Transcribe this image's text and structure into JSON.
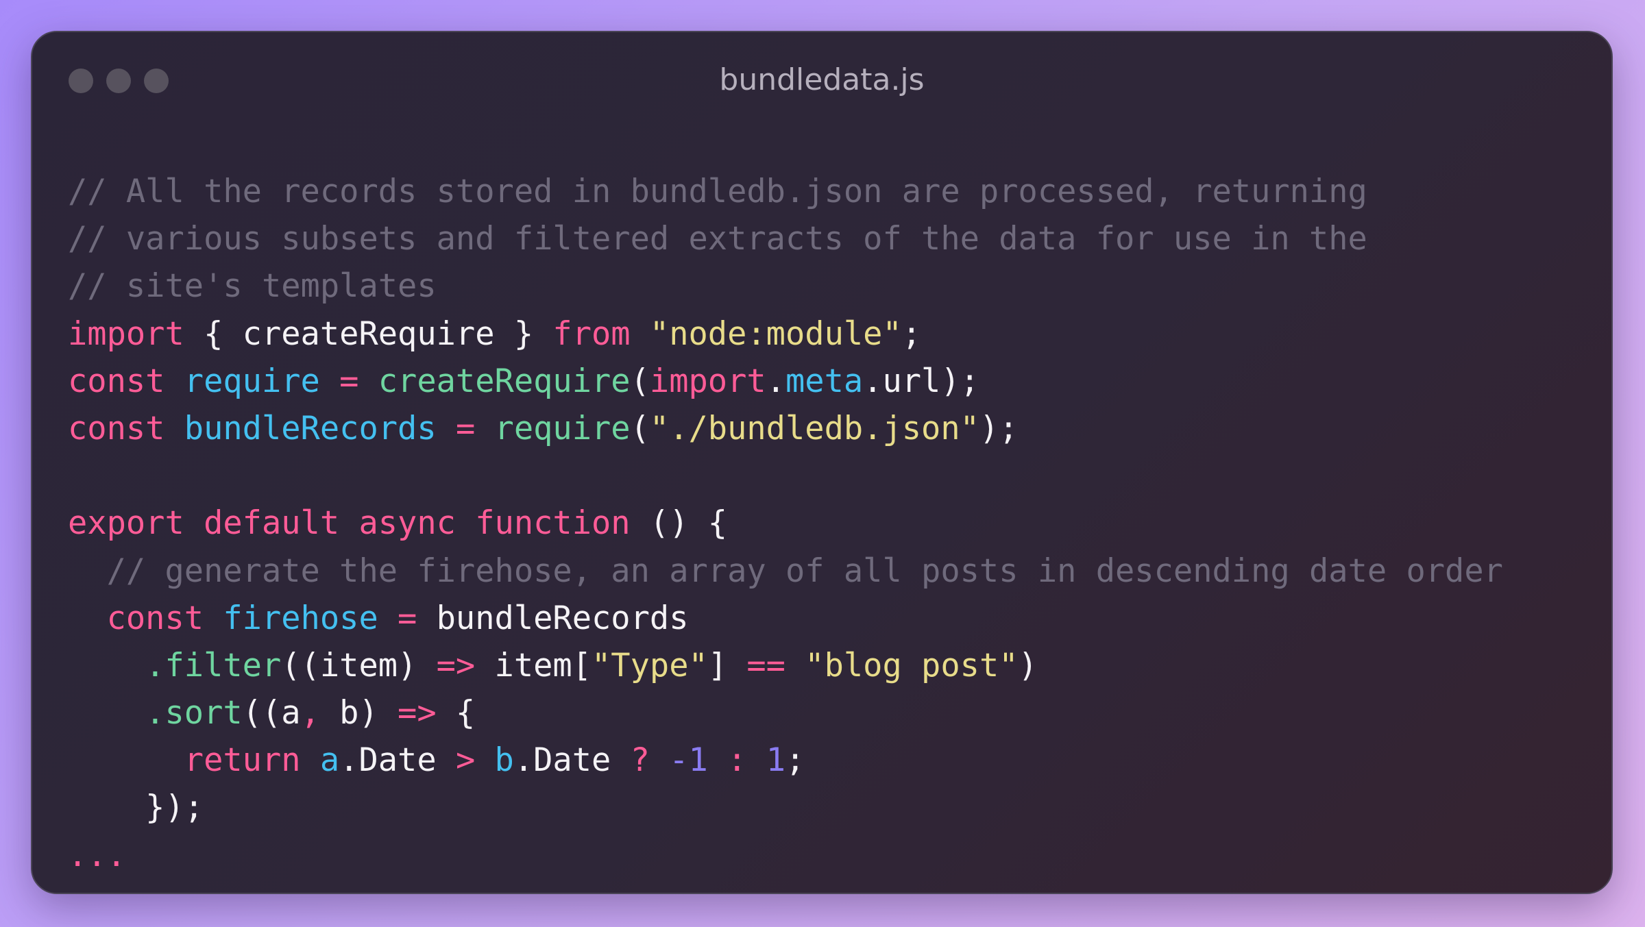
{
  "window": {
    "title": "bundledata.js",
    "controls": [
      "close",
      "minimize",
      "maximize"
    ]
  },
  "colors": {
    "background_gradient": [
      "#a78bfa",
      "#dcb2ee"
    ],
    "window_bg": "#2b2538",
    "comment": "#6f6a7c",
    "keyword": "#ff5c97",
    "variable": "#44c0f0",
    "function": "#6fd5a0",
    "string": "#e8dc8a",
    "plain": "#f5f3f6",
    "number": "#8a7cf2"
  },
  "code": {
    "language": "javascript",
    "lines": [
      {
        "tokens": [
          {
            "t": "cmt",
            "v": "// All the records stored in bundledb.json are processed, returning"
          }
        ]
      },
      {
        "tokens": [
          {
            "t": "cmt",
            "v": "// various subsets and filtered extracts of the data for use in the"
          }
        ]
      },
      {
        "tokens": [
          {
            "t": "cmt",
            "v": "// site's templates"
          }
        ]
      },
      {
        "tokens": [
          {
            "t": "kw",
            "v": "import"
          },
          {
            "t": "pl",
            "v": " { createRequire } "
          },
          {
            "t": "kw",
            "v": "from"
          },
          {
            "t": "pl",
            "v": " "
          },
          {
            "t": "str",
            "v": "\"node:module\""
          },
          {
            "t": "pl",
            "v": ";"
          }
        ]
      },
      {
        "tokens": [
          {
            "t": "kw",
            "v": "const"
          },
          {
            "t": "pl",
            "v": " "
          },
          {
            "t": "var",
            "v": "require"
          },
          {
            "t": "pl",
            "v": " "
          },
          {
            "t": "kw",
            "v": "="
          },
          {
            "t": "pl",
            "v": " "
          },
          {
            "t": "fn",
            "v": "createRequire"
          },
          {
            "t": "pl",
            "v": "("
          },
          {
            "t": "kw",
            "v": "import"
          },
          {
            "t": "pl",
            "v": "."
          },
          {
            "t": "var",
            "v": "meta"
          },
          {
            "t": "pl",
            "v": ".url);"
          }
        ]
      },
      {
        "tokens": [
          {
            "t": "kw",
            "v": "const"
          },
          {
            "t": "pl",
            "v": " "
          },
          {
            "t": "var",
            "v": "bundleRecords"
          },
          {
            "t": "pl",
            "v": " "
          },
          {
            "t": "kw",
            "v": "="
          },
          {
            "t": "pl",
            "v": " "
          },
          {
            "t": "fn",
            "v": "require"
          },
          {
            "t": "pl",
            "v": "("
          },
          {
            "t": "str",
            "v": "\"./bundledb.json\""
          },
          {
            "t": "pl",
            "v": ");"
          }
        ]
      },
      {
        "tokens": []
      },
      {
        "tokens": [
          {
            "t": "kw",
            "v": "export default async function"
          },
          {
            "t": "pl",
            "v": " () {"
          }
        ]
      },
      {
        "tokens": [
          {
            "t": "pl",
            "v": "  "
          },
          {
            "t": "cmt",
            "v": "// generate the firehose, an array of all posts in descending date order"
          }
        ]
      },
      {
        "tokens": [
          {
            "t": "pl",
            "v": "  "
          },
          {
            "t": "kw",
            "v": "const"
          },
          {
            "t": "pl",
            "v": " "
          },
          {
            "t": "var",
            "v": "firehose"
          },
          {
            "t": "pl",
            "v": " "
          },
          {
            "t": "kw",
            "v": "="
          },
          {
            "t": "pl",
            "v": " bundleRecords"
          }
        ]
      },
      {
        "tokens": [
          {
            "t": "pl",
            "v": "    "
          },
          {
            "t": "fn",
            "v": ".filter"
          },
          {
            "t": "pl",
            "v": "((item) "
          },
          {
            "t": "kw",
            "v": "=>"
          },
          {
            "t": "pl",
            "v": " item["
          },
          {
            "t": "str",
            "v": "\"Type\""
          },
          {
            "t": "pl",
            "v": "] "
          },
          {
            "t": "kw",
            "v": "=="
          },
          {
            "t": "pl",
            "v": " "
          },
          {
            "t": "str",
            "v": "\"blog post\""
          },
          {
            "t": "pl",
            "v": ")"
          }
        ]
      },
      {
        "tokens": [
          {
            "t": "pl",
            "v": "    "
          },
          {
            "t": "fn",
            "v": ".sort"
          },
          {
            "t": "pl",
            "v": "((a"
          },
          {
            "t": "kw",
            "v": ","
          },
          {
            "t": "pl",
            "v": " b) "
          },
          {
            "t": "kw",
            "v": "=>"
          },
          {
            "t": "pl",
            "v": " {"
          }
        ]
      },
      {
        "tokens": [
          {
            "t": "pl",
            "v": "      "
          },
          {
            "t": "kw",
            "v": "return"
          },
          {
            "t": "pl",
            "v": " "
          },
          {
            "t": "var",
            "v": "a"
          },
          {
            "t": "pl",
            "v": ".Date "
          },
          {
            "t": "kw",
            "v": ">"
          },
          {
            "t": "pl",
            "v": " "
          },
          {
            "t": "var",
            "v": "b"
          },
          {
            "t": "pl",
            "v": ".Date "
          },
          {
            "t": "kw",
            "v": "?"
          },
          {
            "t": "pl",
            "v": " "
          },
          {
            "t": "num",
            "v": "-1"
          },
          {
            "t": "pl",
            "v": " "
          },
          {
            "t": "kw",
            "v": ":"
          },
          {
            "t": "pl",
            "v": " "
          },
          {
            "t": "num",
            "v": "1"
          },
          {
            "t": "pl",
            "v": ";"
          }
        ]
      },
      {
        "tokens": [
          {
            "t": "pl",
            "v": "    });"
          }
        ]
      },
      {
        "tokens": [
          {
            "t": "kw",
            "v": "..."
          }
        ]
      }
    ]
  }
}
